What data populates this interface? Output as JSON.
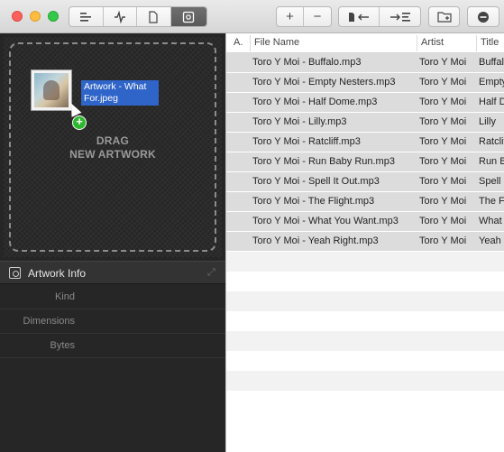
{
  "toolbar": {
    "left_segment_icons": [
      "align-left-icon",
      "waveform-icon",
      "document-icon",
      "artwork-icon"
    ],
    "active_segment_index": 3,
    "add_label": "+",
    "remove_label": "−",
    "import_label": "←",
    "export_label": "→",
    "folder_label": "",
    "minus_circle_label": ""
  },
  "artwork": {
    "drag_line1": "DRAG",
    "drag_line2": "NEW ARTWORK",
    "dragged_file_label": "Artwork - What For.jpeg",
    "plus_badge": "+"
  },
  "info": {
    "title": "Artwork Info",
    "rows": [
      "Kind",
      "Dimensions",
      "Bytes"
    ]
  },
  "table": {
    "columns": [
      "A.",
      "File Name",
      "Artist",
      "Title"
    ],
    "rows": [
      {
        "file": "Toro Y Moi - Buffalo.mp3",
        "artist": "Toro Y Moi",
        "title": "Buffalo"
      },
      {
        "file": "Toro Y Moi - Empty Nesters.mp3",
        "artist": "Toro Y Moi",
        "title": "Empty Nesters"
      },
      {
        "file": "Toro Y Moi - Half Dome.mp3",
        "artist": "Toro Y Moi",
        "title": "Half Dome"
      },
      {
        "file": "Toro Y Moi - Lilly.mp3",
        "artist": "Toro Y Moi",
        "title": "Lilly"
      },
      {
        "file": "Toro Y Moi - Ratcliff.mp3",
        "artist": "Toro Y Moi",
        "title": "Ratcliff"
      },
      {
        "file": "Toro Y Moi - Run Baby Run.mp3",
        "artist": "Toro Y Moi",
        "title": "Run Baby Run"
      },
      {
        "file": "Toro Y Moi - Spell It Out.mp3",
        "artist": "Toro Y Moi",
        "title": "Spell It Out"
      },
      {
        "file": "Toro Y Moi - The Flight.mp3",
        "artist": "Toro Y Moi",
        "title": "The Flight"
      },
      {
        "file": "Toro Y Moi - What You Want.mp3",
        "artist": "Toro Y Moi",
        "title": "What You Want"
      },
      {
        "file": "Toro Y Moi - Yeah Right.mp3",
        "artist": "Toro Y Moi",
        "title": "Yeah Right"
      }
    ]
  }
}
